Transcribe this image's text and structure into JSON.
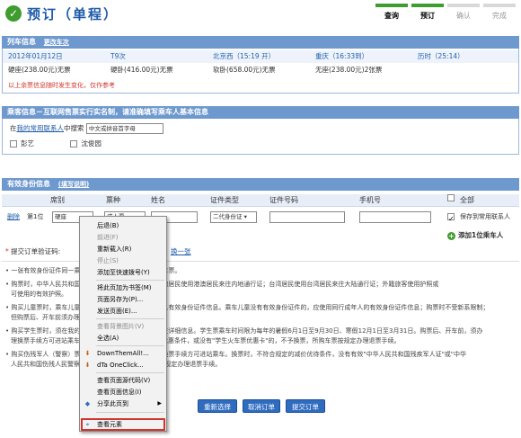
{
  "header": {
    "title": "预订（单程）",
    "steps": [
      {
        "label": "查询",
        "done": true
      },
      {
        "label": "预订",
        "done": true
      },
      {
        "label": "确认",
        "done": false
      },
      {
        "label": "完成",
        "done": false
      }
    ]
  },
  "train_info": {
    "heading": "列车信息",
    "change_link": "更改车次",
    "date": "2012年01月12日",
    "train_no": "T9次",
    "from": "北京西（15:19 开）",
    "to": "重庆（16:33到）",
    "duration": "历时（25:14）",
    "seats": [
      "硬座(238.00元)无票",
      "硬卧(416.00元)无票",
      "软卧(658.00元)无票",
      "无座(238.00元)2张票"
    ],
    "note": "以上余票信息随时发生变化，仅作参考"
  },
  "passenger_info": {
    "heading": "乘客信息－互联网售票实行实名制，请准确填写乘车人基本信息",
    "contact_prefix": "在",
    "contact_link": "我的常用联系人",
    "contact_suffix": "中搜索",
    "search_placeholder": "中文或拼音首字母",
    "contacts": [
      {
        "name": "彭艺"
      },
      {
        "name": "沈俊园"
      }
    ]
  },
  "id_info": {
    "heading": "有效身份信息",
    "fill_help": "(填写说明)",
    "columns": [
      "席别",
      "票种",
      "姓名",
      "证件类型",
      "证件号码",
      "手机号",
      "全部"
    ],
    "row": {
      "delete": "删除",
      "index": "第1位",
      "seat": "硬座",
      "ticket": "成人票",
      "id_type": "二代身份证",
      "save_label": "保存到常用联系人"
    },
    "add_label": "添加1位乘车人",
    "captcha_label": "提交订单验证码:",
    "refresh_label": "换一张"
  },
  "notes": [
    "一张有效身份证件同一乘车日期同一车次只能购买一张车票。",
    "购票时，中华人民共和国居民使用二代居民身份证；港澳居民使用港澳居民来往内地通行证；台湾居民使用台湾居民来往大陆通行证；外籍旅客使用护照或",
    "可使用的有效护照。",
    "购买儿童票时，乘车儿童有有效身份证件的，请填写本人有效身份证件信息。乘车儿童没有有效身份证件的，应使用同行成年人的有效身份证件信息；购票时不受新系限制；",
    "但购票后、开车前须办理换票手续方可进站乘车。",
    "购买学生票时，须在我的常用联系人中登记乘车人的学生详细信息。学生票乘车时间限为每年的暑假6月1日至9月30日、寒假12月1日至3月31日。购票后、开车前，须办",
    "理换票手续方可进站乘车。换票时，不符合有关学生票优惠条件，或没有\"学生火车票优惠卡\"的，不予换票，所购车票按规定办理退票手续。",
    "购买伤残军人（警察）票时，须在购票后、开车前办理换票手续方可进站乘车。换票时，不符合规定的减价优待条件，没有有效\"中华人民共和国残疾军人证\"或\"中华",
    "人民共和国伤残人民警察证\"的，不予换票，所购车票按规定办理退票手续。"
  ],
  "buttons": {
    "select_again": "重新选择",
    "cancel": "取消订单",
    "submit": "提交订单"
  },
  "context_menu": {
    "items": [
      {
        "label": "后退(B)",
        "icon": "",
        "disabled": false
      },
      {
        "label": "前进(F)",
        "icon": "",
        "disabled": true
      },
      {
        "label": "重新载入(R)",
        "icon": "",
        "disabled": false
      },
      {
        "label": "停止(S)",
        "icon": "",
        "disabled": true
      },
      {
        "label": "添加至快速拨号(Y)",
        "icon": "",
        "disabled": false
      },
      {
        "label": "将此页加为书签(M)",
        "icon": "",
        "disabled": false
      },
      {
        "label": "页面另存为(P)...",
        "icon": "",
        "disabled": false
      },
      {
        "label": "发送页面(E)...",
        "icon": "",
        "disabled": false
      },
      {
        "label": "查看背景图片(V)",
        "icon": "",
        "disabled": true
      },
      {
        "label": "全选(A)",
        "icon": "",
        "disabled": false
      },
      {
        "label": "DownThemAll!...",
        "icon": "down-arrow-icon",
        "disabled": false
      },
      {
        "label": "dTa OneClick...",
        "icon": "down-arrow-icon",
        "disabled": false
      },
      {
        "label": "查看页面源代码(V)",
        "icon": "",
        "disabled": false
      },
      {
        "label": "查看页面信息(I)",
        "icon": "",
        "disabled": false
      },
      {
        "label": "分享此页到",
        "icon": "share-icon",
        "disabled": false
      },
      {
        "label": "查看元素",
        "icon": "inspect-icon",
        "disabled": false
      }
    ]
  }
}
